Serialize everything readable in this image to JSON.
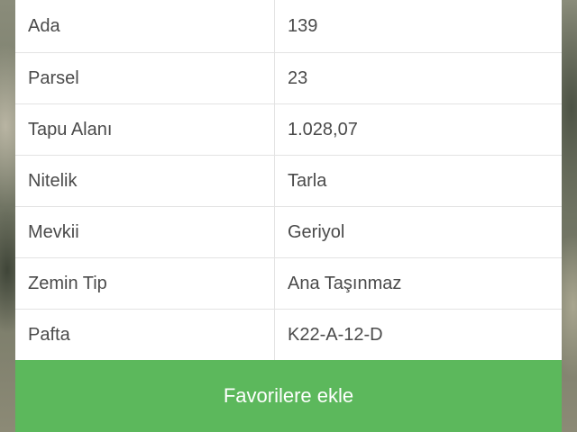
{
  "parcel_details": {
    "rows": [
      {
        "label": "Ada",
        "value": "139"
      },
      {
        "label": "Parsel",
        "value": "23"
      },
      {
        "label": "Tapu Alanı",
        "value": "1.028,07"
      },
      {
        "label": "Nitelik",
        "value": "Tarla"
      },
      {
        "label": "Mevkii",
        "value": "Geriyol"
      },
      {
        "label": "Zemin Tip",
        "value": "Ana Taşınmaz"
      },
      {
        "label": "Pafta",
        "value": "K22-A-12-D"
      }
    ]
  },
  "actions": {
    "favorite_label": "Favorilere ekle"
  },
  "colors": {
    "button_green": "#5cb85c",
    "text": "#4a4a4a",
    "divider": "#e3e3e3"
  }
}
